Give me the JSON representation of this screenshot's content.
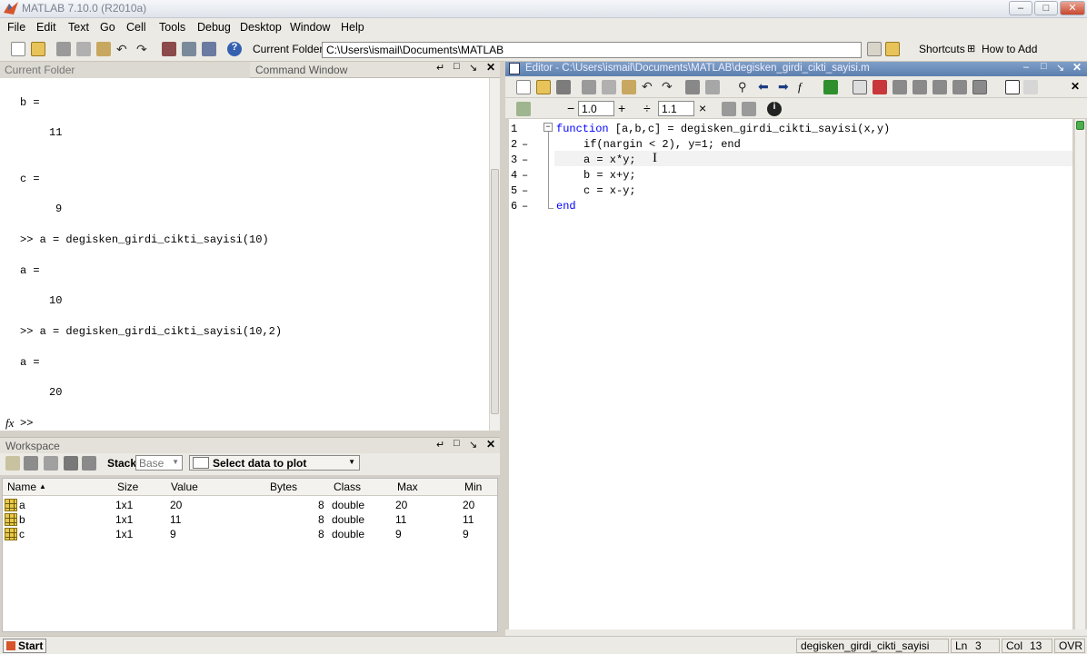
{
  "window": {
    "title": "MATLAB 7.10.0 (R2010a)"
  },
  "menu": [
    "File",
    "Edit",
    "Text",
    "Go",
    "Cell",
    "Tools",
    "Debug",
    "Desktop",
    "Window",
    "Help"
  ],
  "toolbar": {
    "current_folder_label": "Current Folder:",
    "current_folder_path": "C:\\Users\\ismail\\Documents\\MATLAB",
    "shortcuts_label": "Shortcuts",
    "how_to_add_label": "How to Add"
  },
  "panels": {
    "current_folder_tab": "Current Folder",
    "command_window_tab": "Command Window",
    "workspace_title": "Workspace",
    "editor_title": "Editor - C:\\Users\\ismail\\Documents\\MATLAB\\degisken_girdi_cikti_sayisi.m"
  },
  "command_window": {
    "lines": [
      "b =",
      "11",
      "c =",
      "9",
      ">> a = degisken_girdi_cikti_sayisi(10)",
      "a =",
      "10",
      ">> a = degisken_girdi_cikti_sayisi(10,2)",
      "a =",
      "20"
    ],
    "prompt": ">>",
    "fx": "fx"
  },
  "workspace": {
    "stack_label": "Stack:",
    "stack_value": "Base",
    "plot_label": "Select data to plot",
    "columns": [
      "Name",
      "Size",
      "Value",
      "Bytes",
      "Class",
      "Max",
      "Min"
    ],
    "rows": [
      {
        "name": "a",
        "size": "1x1",
        "value": "20",
        "bytes": "8",
        "class": "double",
        "max": "20",
        "min": "20"
      },
      {
        "name": "b",
        "size": "1x1",
        "value": "11",
        "bytes": "8",
        "class": "double",
        "max": "11",
        "min": "11"
      },
      {
        "name": "c",
        "size": "1x1",
        "value": "9",
        "bytes": "8",
        "class": "double",
        "max": "9",
        "min": "9"
      }
    ]
  },
  "editor": {
    "cell_minus": "−",
    "cell_value1": "1.0",
    "cell_plus": "+",
    "cell_divide": "÷",
    "cell_value2": "1.1",
    "cell_times": "×",
    "code": [
      {
        "n": "1",
        "dash": "",
        "text": "function [a,b,c] = degisken_girdi_cikti_sayisi(x,y)",
        "kw": "function"
      },
      {
        "n": "2",
        "dash": "–",
        "text": "if(nargin < 2), y=1; end",
        "kw": ""
      },
      {
        "n": "3",
        "dash": "–",
        "text": "a = x*y;",
        "kw": ""
      },
      {
        "n": "4",
        "dash": "–",
        "text": "b = x+y;",
        "kw": ""
      },
      {
        "n": "5",
        "dash": "–",
        "text": "c = x-y;",
        "kw": ""
      },
      {
        "n": "6",
        "dash": "–",
        "text": "end",
        "kw": "end"
      }
    ]
  },
  "statusbar": {
    "start": "Start",
    "file": "degisken_girdi_cikti_sayisi",
    "ln_label": "Ln",
    "ln_value": "3",
    "col_label": "Col",
    "col_value": "13",
    "mode": "OVR"
  },
  "colors": {
    "keyword": "#0000ff",
    "highlight_line": "#f2f2f2"
  }
}
